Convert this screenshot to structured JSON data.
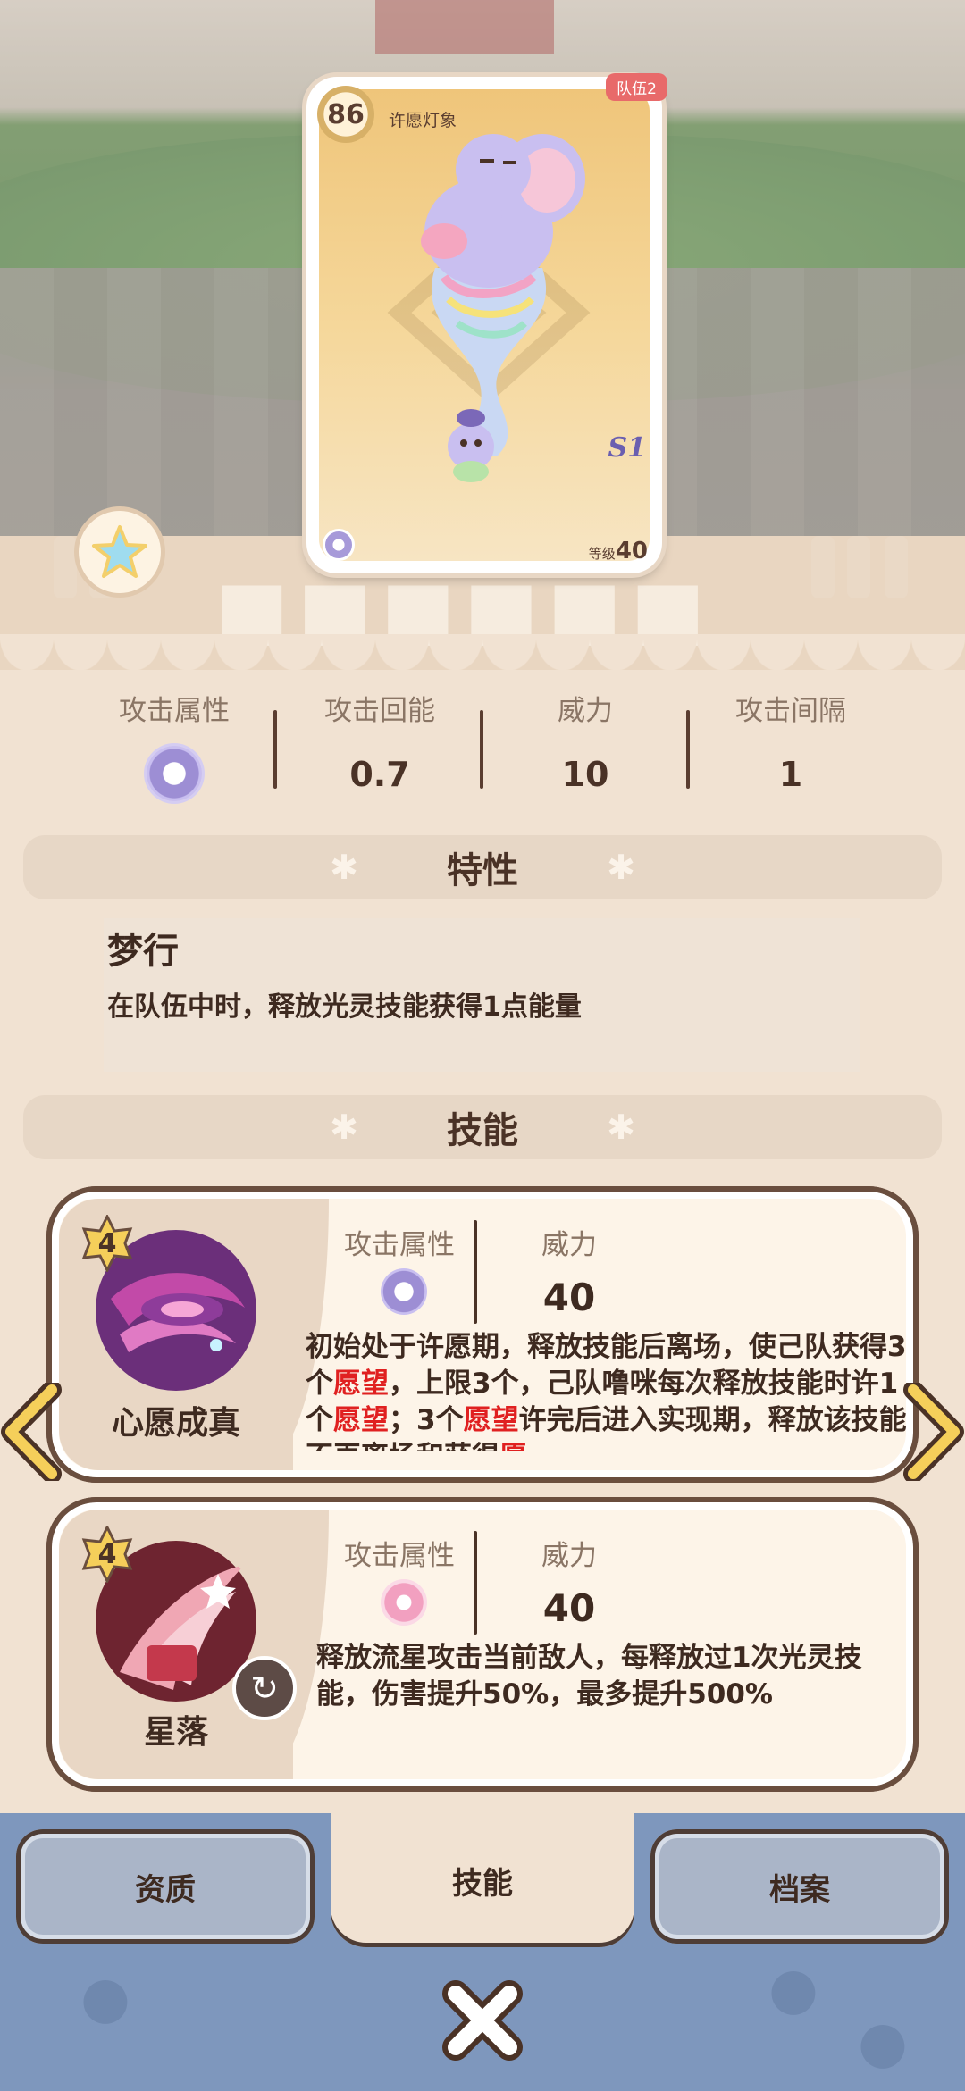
{
  "card": {
    "level_badge": "86",
    "name": "许愿灯象",
    "team_tag": "队伍2",
    "season_mark": "S1",
    "level_label": "等级",
    "level_value": "40"
  },
  "stats": [
    {
      "label": "攻击属性",
      "value": ""
    },
    {
      "label": "攻击回能",
      "value": "0.7"
    },
    {
      "label": "威力",
      "value": "10"
    },
    {
      "label": "攻击间隔",
      "value": "1"
    }
  ],
  "traits_section": {
    "title": "特性"
  },
  "trait": {
    "name": "梦行",
    "desc": "在队伍中时，释放光灵技能获得1点能量"
  },
  "skills_section": {
    "title": "技能"
  },
  "skills": [
    {
      "cost": "4",
      "name": "心愿成真",
      "attr_label": "攻击属性",
      "power_label": "威力",
      "power": "40",
      "desc_parts": [
        "初始处于许愿期，释放技能后离场，使己队获得3个",
        "愿望",
        "，上限3个，己队噜咪每次释放技能时许1个",
        "愿望",
        "；3个",
        "愿望",
        "许完后进入实现期，释放该技能不再离场和获得",
        "愿"
      ]
    },
    {
      "cost": "4",
      "name": "星落",
      "attr_label": "攻击属性",
      "power_label": "威力",
      "power": "40",
      "desc": "释放流星攻击当前敌人，每释放过1次光灵技能，伤害提升50%，最多提升500%"
    }
  ],
  "tabs": [
    {
      "label": "资质",
      "active": false
    },
    {
      "label": "技能",
      "active": true
    },
    {
      "label": "档案",
      "active": false
    }
  ],
  "colors": {
    "highlight": "#e02020",
    "panel": "#f1e2d2",
    "bottom_bar": "#7e97bd",
    "tab_inactive": "#aab5c8"
  },
  "icons": [
    "star-icon",
    "light-element-icon",
    "petal-element-icon",
    "refresh-icon",
    "chevron-left-icon",
    "chevron-right-icon",
    "close-icon",
    "paw-icon"
  ]
}
